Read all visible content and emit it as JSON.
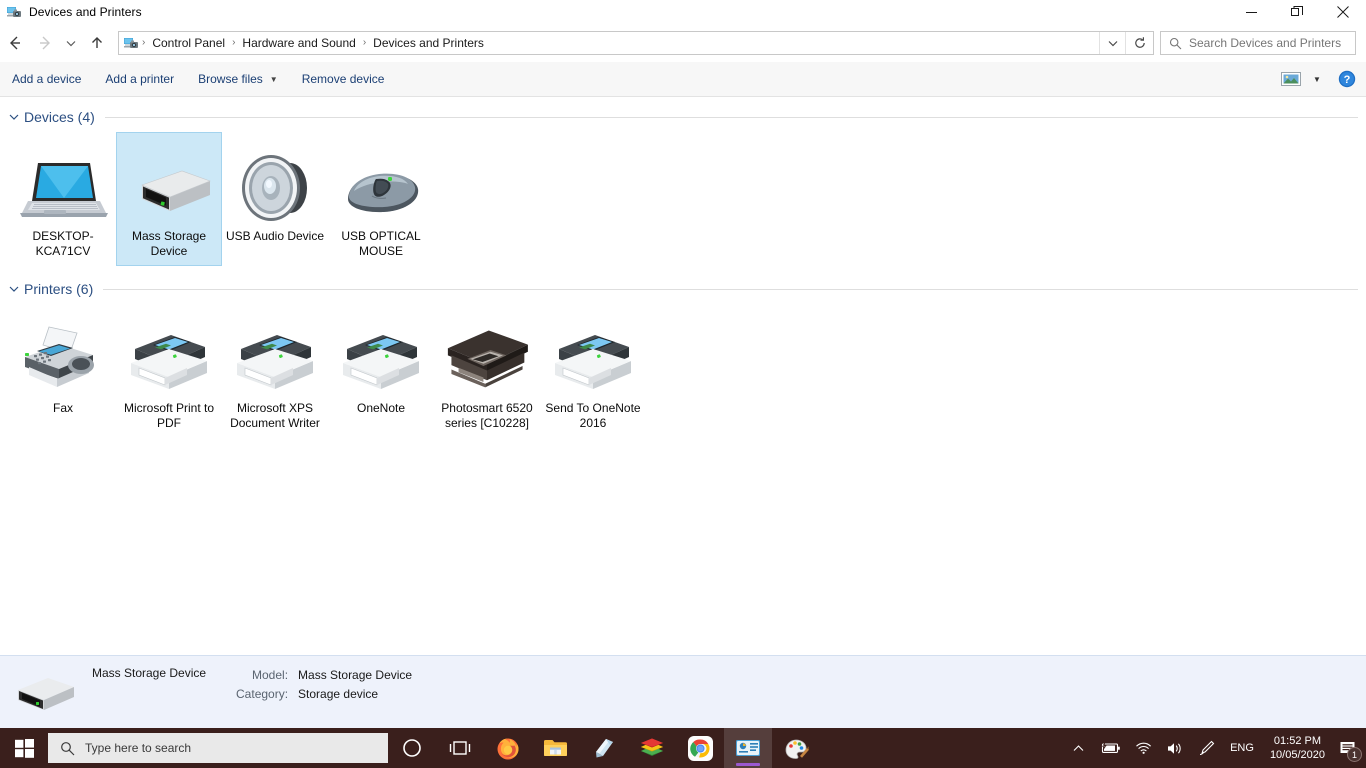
{
  "window": {
    "title": "Devices and Printers",
    "icon": "devices-and-printers-icon",
    "minimize_label": "Minimize",
    "restore_label": "Restore",
    "close_label": "Close"
  },
  "nav": {
    "back_label": "Back",
    "forward_label": "Forward",
    "recent_label": "Recent locations",
    "up_label": "Up",
    "refresh_label": "Refresh",
    "history_label": "Previous locations",
    "breadcrumbs": [
      "Control Panel",
      "Hardware and Sound",
      "Devices and Printers"
    ],
    "separator": "›"
  },
  "search": {
    "placeholder": "Search Devices and Printers",
    "icon": "search-icon"
  },
  "commandbar": {
    "items": [
      {
        "label": "Add a device",
        "has_caret": false
      },
      {
        "label": "Add a printer",
        "has_caret": false
      },
      {
        "label": "Browse files",
        "has_caret": true
      },
      {
        "label": "Remove device",
        "has_caret": false
      }
    ],
    "view_label": "Change your view",
    "help_label": "Help"
  },
  "groups": [
    {
      "title": "Devices (4)",
      "name": "devices",
      "items": [
        {
          "label": "DESKTOP-KCA71CV",
          "icon": "laptop-icon",
          "selected": false
        },
        {
          "label": "Mass Storage Device",
          "icon": "external-drive-icon",
          "selected": true
        },
        {
          "label": "USB Audio Device",
          "icon": "speaker-icon",
          "selected": false
        },
        {
          "label": "USB OPTICAL MOUSE",
          "icon": "mouse-icon",
          "selected": false
        }
      ]
    },
    {
      "title": "Printers (6)",
      "name": "printers",
      "items": [
        {
          "label": "Fax",
          "icon": "fax-icon",
          "selected": false
        },
        {
          "label": "Microsoft Print to PDF",
          "icon": "printer-icon",
          "selected": false
        },
        {
          "label": "Microsoft XPS Document Writer",
          "icon": "printer-icon",
          "selected": false
        },
        {
          "label": "OneNote",
          "icon": "printer-icon",
          "selected": false
        },
        {
          "label": "Photosmart 6520 series [C10228]",
          "icon": "photo-printer-icon",
          "selected": false
        },
        {
          "label": "Send To OneNote 2016",
          "icon": "printer-icon",
          "selected": false
        }
      ]
    }
  ],
  "details": {
    "icon": "external-drive-icon",
    "name": "Mass Storage Device",
    "fields": [
      {
        "key": "Model:",
        "value": "Mass Storage Device"
      },
      {
        "key": "Category:",
        "value": "Storage device"
      }
    ]
  },
  "taskbar": {
    "start_label": "Start",
    "search_placeholder": "Type here to search",
    "search_icon": "search-icon",
    "items": [
      {
        "name": "cortana-icon",
        "label": "Cortana",
        "active": false,
        "running": false
      },
      {
        "name": "task-view-icon",
        "label": "Task View",
        "active": false,
        "running": false
      },
      {
        "name": "firefox-icon",
        "label": "Firefox",
        "active": false,
        "running": true
      },
      {
        "name": "file-explorer-icon",
        "label": "File Explorer",
        "active": false,
        "running": true
      },
      {
        "name": "sticky-notes-icon",
        "label": "Sticky Notes",
        "active": false,
        "running": false
      },
      {
        "name": "winrar-icon",
        "label": "WinRAR",
        "active": false,
        "running": false
      },
      {
        "name": "chrome-icon",
        "label": "Google Chrome",
        "active": false,
        "running": false
      },
      {
        "name": "devices-and-printers-icon",
        "label": "Devices and Printers",
        "active": true,
        "running": true
      },
      {
        "name": "paint-icon",
        "label": "Paint 3D",
        "active": false,
        "running": false
      }
    ],
    "tray": {
      "overflow_icon": "chevron-up-icon",
      "battery_icon": "battery-charging-icon",
      "network_icon": "wifi-icon",
      "volume_icon": "speaker-volume-icon",
      "pen_icon": "windows-ink-icon",
      "language": "ENG",
      "time": "01:52 PM",
      "date": "10/05/2020",
      "notification_icon": "action-center-icon",
      "notification_count": "1"
    }
  },
  "colors": {
    "accent_blue": "#2c4f82",
    "command_link": "#1b3f74",
    "selection_fill": "#cce8f7",
    "selection_border": "#a3d3ee",
    "details_bg": "#eef2fb",
    "taskbar_bg": "#3a1f1c",
    "running_underline": "#9b59d0"
  }
}
